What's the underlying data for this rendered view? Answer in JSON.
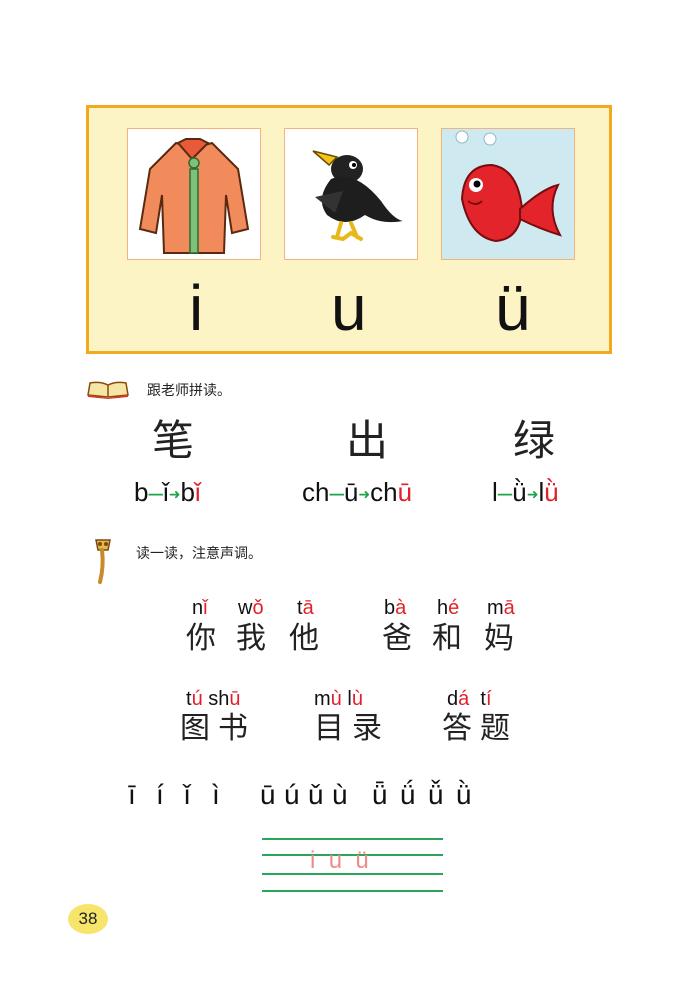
{
  "panel": {
    "images": [
      {
        "name": "shirt-illustration",
        "icon": "shirt-icon"
      },
      {
        "name": "crow-illustration",
        "icon": "crow-icon"
      },
      {
        "name": "fish-illustration",
        "icon": "fish-icon"
      }
    ],
    "letters": [
      "i",
      "u",
      "ü"
    ]
  },
  "section1": {
    "icon": "book-icon",
    "heading": "跟老师拼读。",
    "items": [
      {
        "char": "笔",
        "initial": "b",
        "vowel": "ǐ",
        "result_initial": "b",
        "result_vowel": "ǐ"
      },
      {
        "char": "出",
        "initial": "ch",
        "vowel": "ū",
        "result_initial": "ch",
        "result_vowel": "ū"
      },
      {
        "char": "绿",
        "initial": "l",
        "vowel": "ǜ",
        "result_initial": "l",
        "result_vowel": "ǜ"
      }
    ]
  },
  "section2": {
    "icon": "torch-icon",
    "heading": "读一读，注意声调。",
    "row1": [
      {
        "pinyin_initial": "n",
        "pinyin_vowel": "ǐ",
        "hanzi": "你"
      },
      {
        "pinyin_initial": "w",
        "pinyin_vowel": "ǒ",
        "hanzi": "我"
      },
      {
        "pinyin_initial": "t",
        "pinyin_vowel": "ā",
        "hanzi": "他"
      },
      {
        "pinyin_initial": "b",
        "pinyin_vowel": "à",
        "hanzi": "爸"
      },
      {
        "pinyin_initial": "h",
        "pinyin_vowel": "é",
        "hanzi": "和"
      },
      {
        "pinyin_initial": "m",
        "pinyin_vowel": "ā",
        "hanzi": "妈"
      }
    ],
    "row2": [
      {
        "pinyin": [
          [
            "t",
            "ú"
          ],
          [
            "sh",
            "ū"
          ]
        ],
        "hanzi": "图书"
      },
      {
        "pinyin": [
          [
            "m",
            "ù"
          ],
          [
            "l",
            "ù"
          ]
        ],
        "hanzi": "目录"
      },
      {
        "pinyin": [
          [
            "d",
            "á"
          ],
          [
            "t",
            "í"
          ]
        ],
        "hanzi": "答题"
      }
    ],
    "tones": [
      "ī",
      "í",
      "ǐ",
      "ì",
      "ū",
      "ú",
      "ǔ",
      "ù",
      "ǖ",
      "ǘ",
      "ǚ",
      "ǜ"
    ]
  },
  "writing": {
    "letters": [
      "i",
      "u",
      "ü"
    ]
  },
  "page_number": "38",
  "colors": {
    "panel_bg": "#fdf4c5",
    "panel_border": "#f2a81f",
    "tone_red": "#e0212a",
    "line_green": "#2aa65a",
    "page_badge": "#f6e56a"
  }
}
